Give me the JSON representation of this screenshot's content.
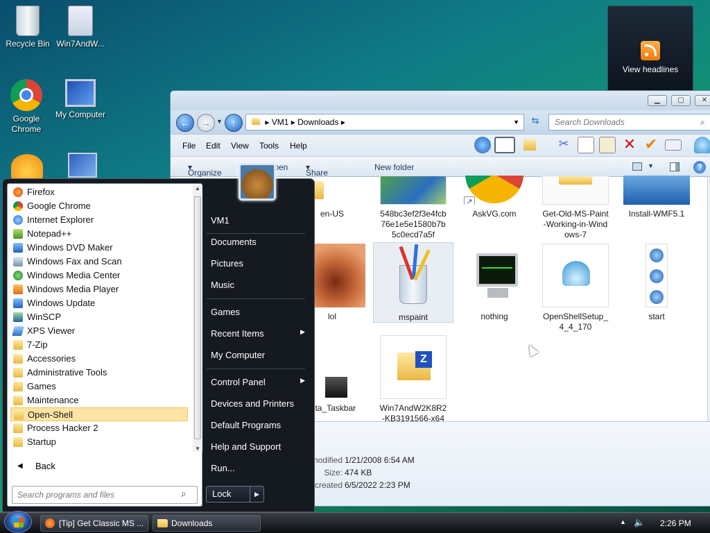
{
  "desktop": {
    "icons": [
      {
        "label": "Recycle Bin"
      },
      {
        "label": "Win7AndW..."
      },
      {
        "label": "Google Chrome"
      },
      {
        "label": "My Computer"
      }
    ]
  },
  "gadget": {
    "label": "View headlines"
  },
  "explorer": {
    "path": [
      "VM1",
      "Downloads"
    ],
    "search_placeholder": "Search Downloads",
    "menu": [
      "File",
      "Edit",
      "View",
      "Tools",
      "Help"
    ],
    "commands": {
      "organize": "Organize",
      "open": "Open",
      "share": "Share with",
      "new_folder": "New folder"
    },
    "files": [
      {
        "label": "en-US"
      },
      {
        "label": "548bc3ef2f3e4fcb76e1e5e1580b7b5c0ecd7a5f"
      },
      {
        "label": "AskVG.com"
      },
      {
        "label": "Get-Old-MS-Paint-Working-in-Windows-7"
      },
      {
        "label": "Install-WMF5.1"
      },
      {
        "label": "lol"
      },
      {
        "label": "mspaint"
      },
      {
        "label": "nothing"
      },
      {
        "label": "OpenShellSetup_4_4_170"
      },
      {
        "label": "start"
      },
      {
        "label": "Vista_Taskbar"
      },
      {
        "label": "Win7AndW2K8R2-KB3191566-x64"
      }
    ],
    "details": {
      "modified_label": "Date modified:",
      "modified": "1/21/2008 6:54 AM",
      "size_label": "Size:",
      "size": "474 KB",
      "created_label": "Date created:",
      "created": "6/5/2022 2:23 PM"
    }
  },
  "startmenu": {
    "programs": [
      {
        "label": "Firefox"
      },
      {
        "label": "Google Chrome"
      },
      {
        "label": "Internet Explorer"
      },
      {
        "label": "Notepad++"
      },
      {
        "label": "Windows DVD Maker"
      },
      {
        "label": "Windows Fax and Scan"
      },
      {
        "label": "Windows Media Center"
      },
      {
        "label": "Windows Media Player"
      },
      {
        "label": "Windows Update"
      },
      {
        "label": "WinSCP"
      },
      {
        "label": "XPS Viewer"
      },
      {
        "label": "7-Zip"
      },
      {
        "label": "Accessories"
      },
      {
        "label": "Administrative Tools"
      },
      {
        "label": "Games"
      },
      {
        "label": "Maintenance"
      },
      {
        "label": "Open-Shell"
      },
      {
        "label": "Process Hacker 2"
      },
      {
        "label": "Startup"
      }
    ],
    "back": "Back",
    "search_placeholder": "Search programs and files",
    "right": [
      {
        "label": "VM1"
      },
      {
        "label": "Documents"
      },
      {
        "label": "Pictures"
      },
      {
        "label": "Music"
      },
      {
        "label": "Games"
      },
      {
        "label": "Recent Items"
      },
      {
        "label": "My Computer"
      },
      {
        "label": "Control Panel"
      },
      {
        "label": "Devices and Printers"
      },
      {
        "label": "Default Programs"
      },
      {
        "label": "Help and Support"
      },
      {
        "label": "Run..."
      }
    ],
    "lock": "Lock"
  },
  "taskbar": {
    "buttons": [
      {
        "label": "[Tip] Get Classic MS ..."
      },
      {
        "label": "Downloads"
      }
    ],
    "clock": "2:26 PM"
  },
  "colors": {
    "selection": "#fde4a4",
    "startmenu_bg": "#151a20"
  }
}
